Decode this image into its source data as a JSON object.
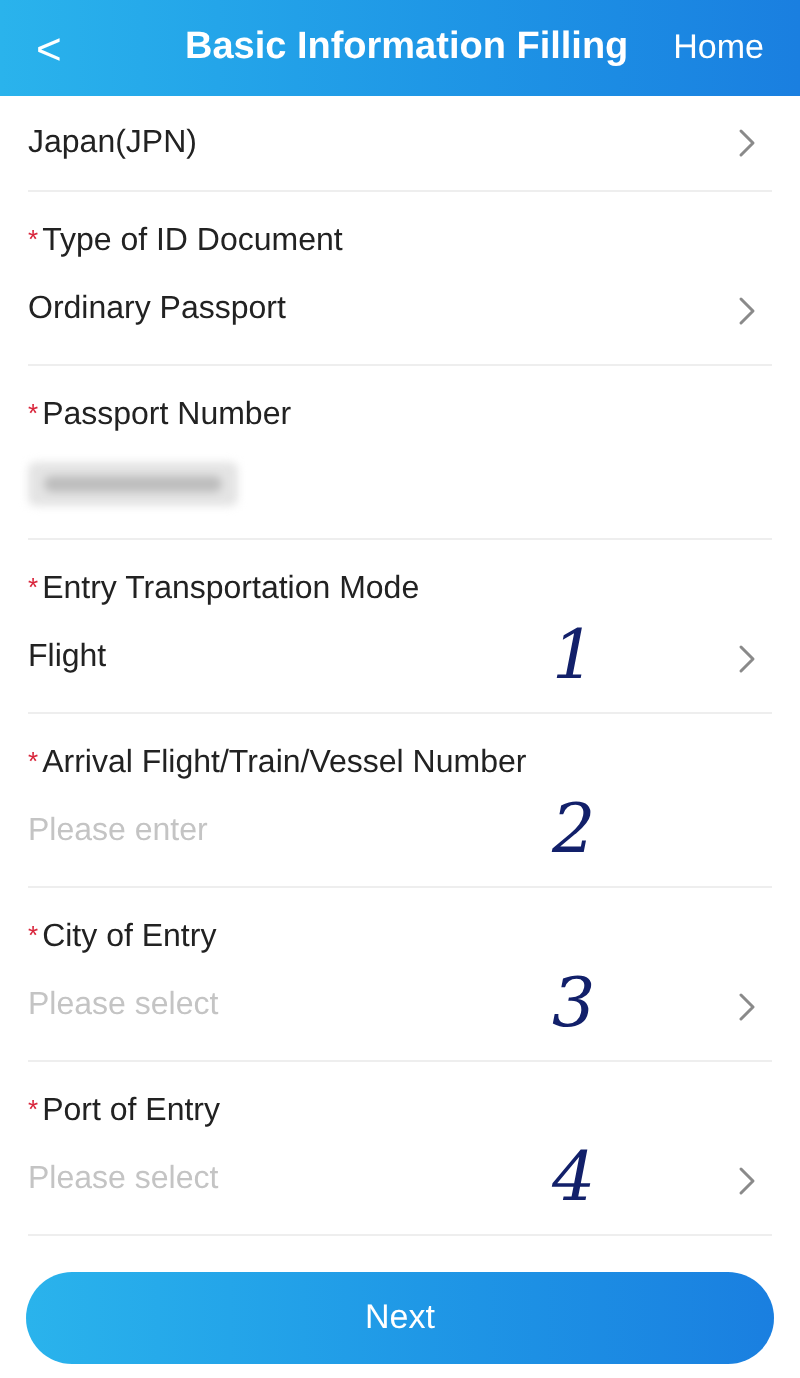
{
  "header": {
    "back": "<",
    "title": "Basic Information Filling",
    "home": "Home"
  },
  "top_row": {
    "value": "Japan(JPN)"
  },
  "fields": [
    {
      "mark": "*",
      "label": "Type of ID Document",
      "kind": "select",
      "value": "Ordinary Passport"
    },
    {
      "mark": "*",
      "label": "Passport Number",
      "kind": "redacted"
    },
    {
      "mark": "*",
      "label": "Entry Transportation Mode",
      "kind": "select",
      "value": "Flight",
      "annotation": "1"
    },
    {
      "mark": "*",
      "label": "Arrival Flight/Train/Vessel Number",
      "kind": "input",
      "placeholder": "Please enter",
      "annotation": "2"
    },
    {
      "mark": "*",
      "label": "City of Entry",
      "kind": "select",
      "placeholder": "Please select",
      "annotation": "3"
    },
    {
      "mark": "*",
      "label": "Port of Entry",
      "kind": "select",
      "placeholder": "Please select",
      "annotation": "4"
    }
  ],
  "next_button": "Next"
}
